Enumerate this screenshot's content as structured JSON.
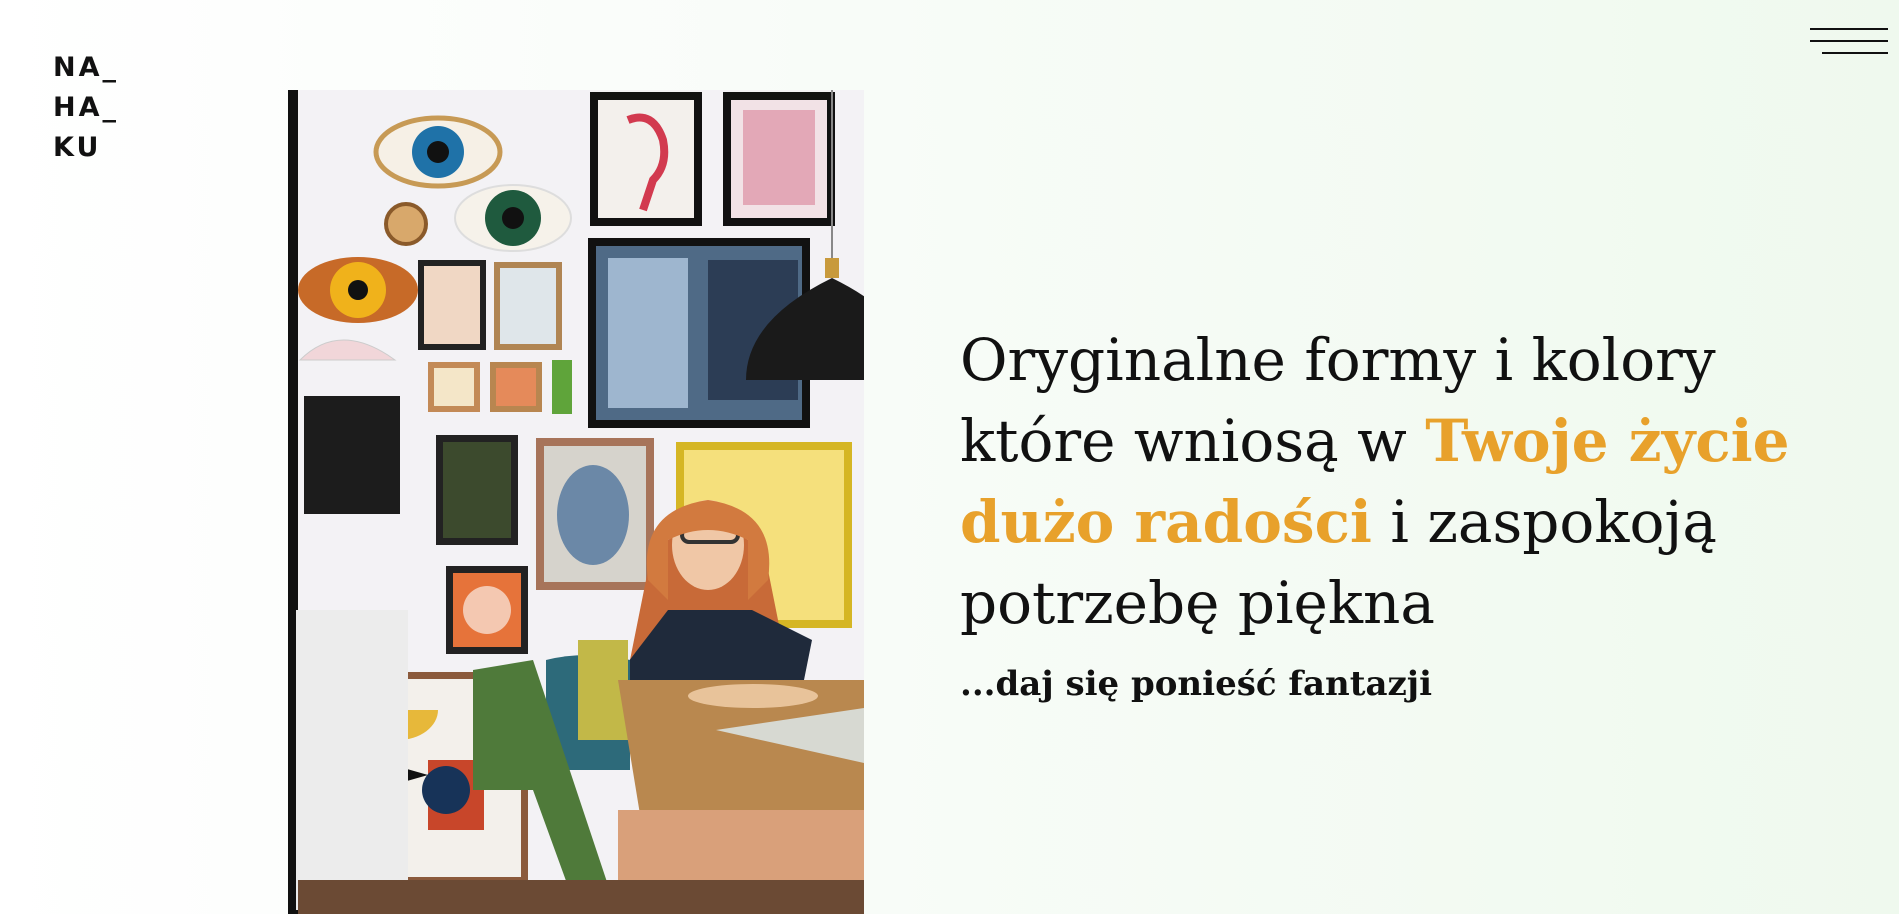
{
  "brand": {
    "logo_lines": [
      "NA_",
      "HA_",
      "KU"
    ]
  },
  "menu": {
    "icon": "hamburger-menu-icon"
  },
  "hero": {
    "image_icon": "interior-photo",
    "headline": {
      "line1": "Oryginalne formy i kolory",
      "line2_a": "które wniosą w ",
      "line2_accent": "Twoje życie",
      "line3_accent": "dużo radości",
      "line3_b": " i zaspokoją",
      "line4": "potrzebę piękna"
    },
    "tagline": "...daj się ponieść fantazji"
  },
  "colors": {
    "accent": "#e8a12b",
    "text": "#111111",
    "background": "#f2faf1"
  }
}
